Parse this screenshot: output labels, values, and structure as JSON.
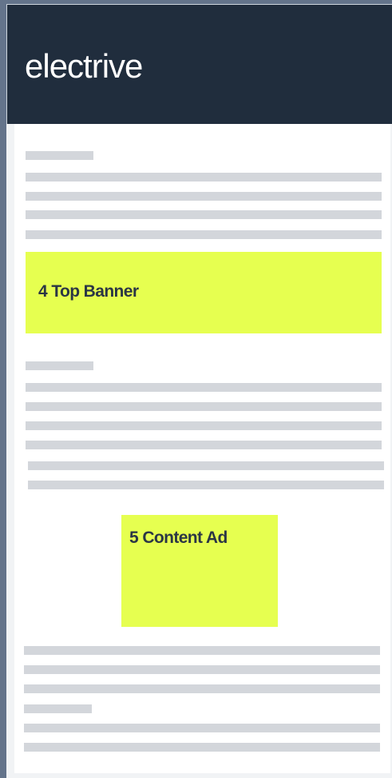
{
  "header": {
    "logo_text": "electrive",
    "background": "#202d3d"
  },
  "ads": {
    "top_banner": {
      "label": "4 Top Banner",
      "color": "#e6ff50"
    },
    "content_ad": {
      "label": "5 Content Ad",
      "color": "#e6ff50"
    }
  },
  "placeholder_color": "#d3d6db"
}
